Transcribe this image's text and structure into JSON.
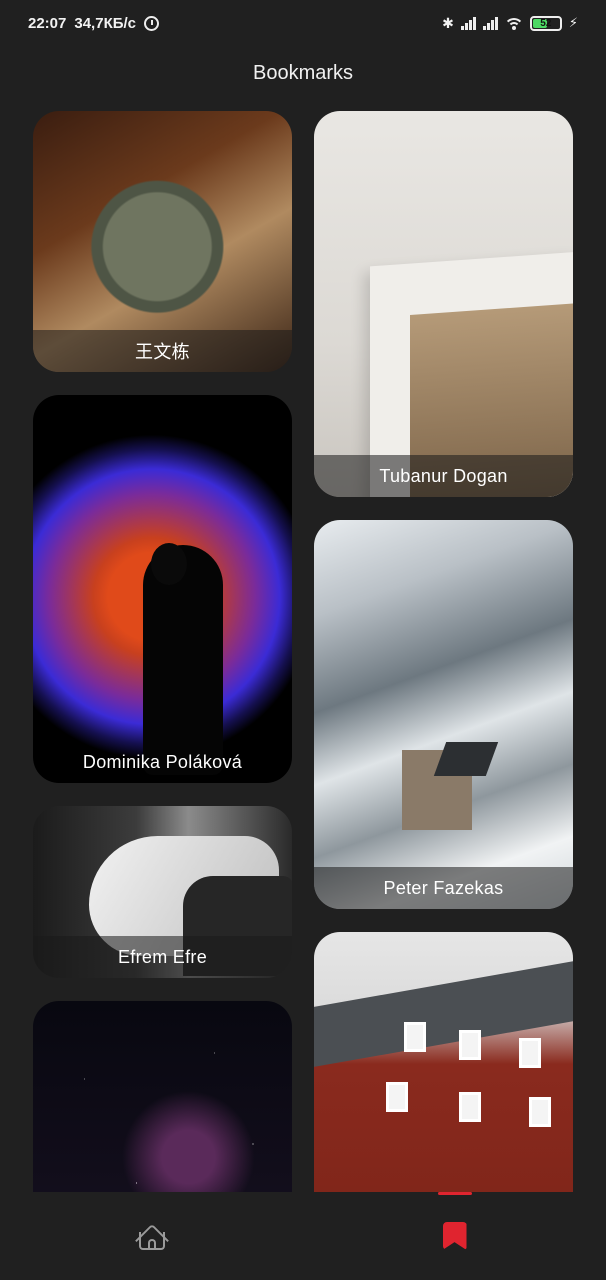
{
  "status_bar": {
    "time": "22:07",
    "speed": "34,7КБ/с",
    "battery": "52"
  },
  "header": {
    "title": "Bookmarks"
  },
  "bookmarks": [
    {
      "author": "王文栋",
      "image": "dessert-plate"
    },
    {
      "author": "Tubanur Dogan",
      "image": "framed-flower"
    },
    {
      "author": "Dominika Poláková",
      "image": "aura-silhouette"
    },
    {
      "author": "Peter Fazekas",
      "image": "snowy-mountain-house"
    },
    {
      "author": "Efrem  Efre",
      "image": "white-horse"
    },
    {
      "author": "",
      "image": "starry-sky"
    },
    {
      "author": "",
      "image": "red-barn"
    }
  ],
  "bottom_nav": {
    "items": [
      {
        "icon": "home-icon",
        "active": false
      },
      {
        "icon": "bookmark-icon",
        "active": true
      }
    ],
    "active_color": "#e0242f"
  }
}
